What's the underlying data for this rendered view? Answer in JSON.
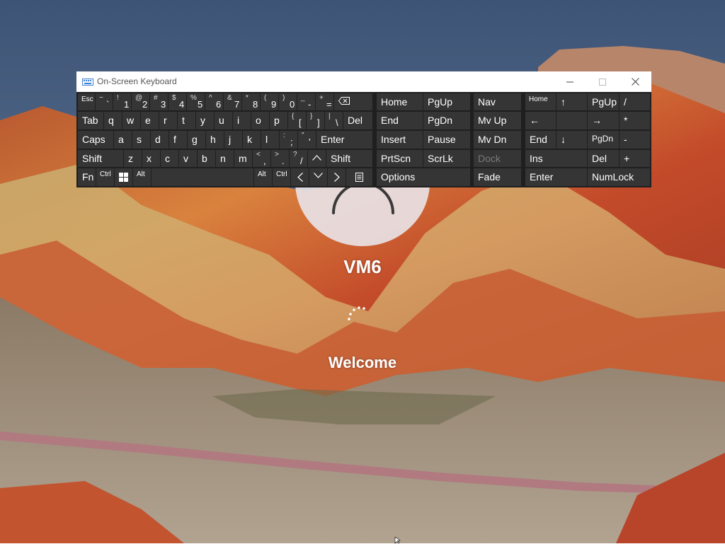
{
  "desktop": {
    "username": "VM6",
    "status": "Welcome"
  },
  "osk": {
    "title": "On-Screen Keyboard",
    "window_buttons": [
      "minimize-icon",
      "maximize-icon",
      "close-icon"
    ],
    "row1": {
      "esc": "Esc",
      "tilde_shift": "~",
      "tilde": "`",
      "n1_shift": "!",
      "n1": "1",
      "n2_shift": "@",
      "n2": "2",
      "n3_shift": "#",
      "n3": "3",
      "n4_shift": "$",
      "n4": "4",
      "n5_shift": "%",
      "n5": "5",
      "n6_shift": "^",
      "n6": "6",
      "n7_shift": "&",
      "n7": "7",
      "n8_shift": "*",
      "n8": "8",
      "n9_shift": "(",
      "n9": "9",
      "n0_shift": ")",
      "n0": "0",
      "minus_shift": "_",
      "minus": "-",
      "equal_shift": "+",
      "equal": "=",
      "backspace_icon": "backspace-icon"
    },
    "row2": {
      "tab": "Tab",
      "q": "q",
      "w": "w",
      "e": "e",
      "r": "r",
      "t": "t",
      "y": "y",
      "u": "u",
      "i": "i",
      "o": "o",
      "p": "p",
      "lbracket_shift": "{",
      "lbracket": "[",
      "rbracket_shift": "}",
      "rbracket": "]",
      "backslash_shift": "|",
      "backslash": "\\",
      "del": "Del"
    },
    "row3": {
      "caps": "Caps",
      "a": "a",
      "s": "s",
      "d": "d",
      "f": "f",
      "g": "g",
      "h": "h",
      "j": "j",
      "k": "k",
      "l": "l",
      "semicolon_shift": ":",
      "semicolon": ";",
      "quote_shift": "\"",
      "quote": "'",
      "enter": "Enter"
    },
    "row4": {
      "shift_left": "Shift",
      "z": "z",
      "x": "x",
      "c": "c",
      "v": "v",
      "b": "b",
      "n": "n",
      "m": "m",
      "comma_shift": "<",
      "comma": ",",
      "period_shift": ">",
      "period": ".",
      "slash_shift": "?",
      "slash": "/",
      "up_icon": "up-arrow-icon",
      "shift_right": "Shift"
    },
    "row5": {
      "fn": "Fn",
      "ctrl_left": "Ctrl",
      "win_icon": "windows-logo-icon",
      "alt_left": "Alt",
      "alt_right": "Alt",
      "ctrl_right": "Ctrl",
      "left_icon": "left-arrow-icon",
      "down_icon": "down-arrow-icon",
      "right_icon": "right-arrow-icon",
      "menu_icon": "context-menu-icon"
    },
    "nav_block": {
      "home": "Home",
      "pgup": "PgUp",
      "end": "End",
      "pgdn": "PgDn",
      "insert": "Insert",
      "pause": "Pause",
      "prtscn": "PrtScn",
      "scrlk": "ScrLk",
      "options": "Options"
    },
    "mode_block": {
      "nav": "Nav",
      "mvup": "Mv Up",
      "mvdn": "Mv Dn",
      "dock": "Dock",
      "fade": "Fade"
    },
    "numpad": {
      "home": "Home",
      "up_arrow": "↑",
      "pgup": "PgUp",
      "divide": "/",
      "left_arrow": "←",
      "right_arrow": "→",
      "multiply": "*",
      "end": "End",
      "down_arrow": "↓",
      "pgdn": "PgDn",
      "minus": "-",
      "ins": "Ins",
      "del": "Del",
      "plus": "+",
      "enter": "Enter",
      "numlock": "NumLock"
    }
  }
}
